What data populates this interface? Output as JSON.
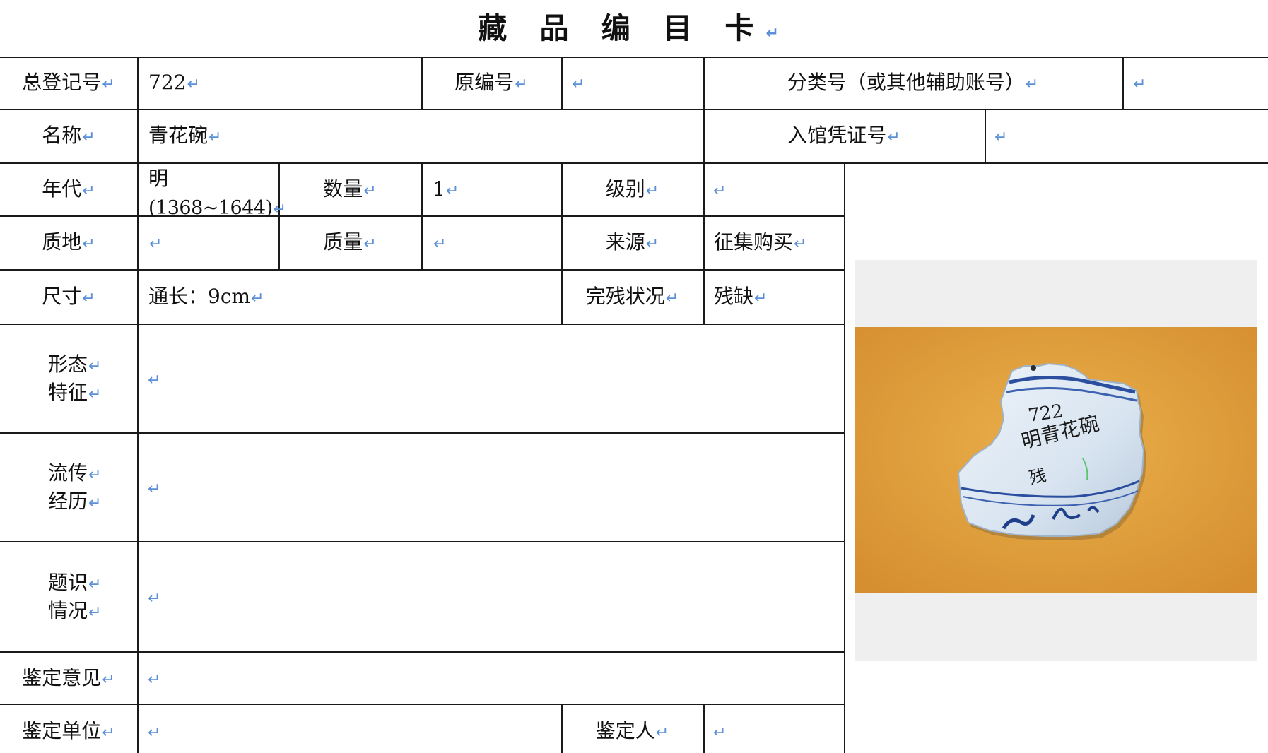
{
  "title": "藏 品 编 目 卡",
  "return_mark": "↵",
  "row1": {
    "total_reg_label": "总登记号",
    "total_reg_value": "722",
    "orig_no_label": "原编号",
    "orig_no_value": "",
    "class_no_label": "分类号（或其他辅助账号）",
    "class_no_value": ""
  },
  "row2": {
    "name_label": "名称",
    "name_value": "青花碗",
    "voucher_label": "入馆凭证号",
    "voucher_value": ""
  },
  "row3": {
    "era_label": "年代",
    "era_value_line1": "明",
    "era_value_line2": "(1368~1644)",
    "qty_label": "数量",
    "qty_value": "1",
    "grade_label": "级别",
    "grade_value": ""
  },
  "row4": {
    "material_label": "质地",
    "material_value": "",
    "weight_label": "质量",
    "weight_value": "",
    "source_label": "来源",
    "source_value": "征集购买"
  },
  "row5": {
    "size_label": "尺寸",
    "size_value": "通长：9cm",
    "condition_label": "完残状况",
    "condition_value": "残缺"
  },
  "form": {
    "label_line1": "形态",
    "label_line2": "特征",
    "value": ""
  },
  "history": {
    "label_line1": "流传",
    "label_line2": "经历",
    "value": ""
  },
  "inscription": {
    "label_line1": "题识",
    "label_line2": "情况",
    "value": ""
  },
  "appraisal": {
    "label": "鉴定意见",
    "value": ""
  },
  "appraisal_unit": {
    "label": "鉴定单位",
    "value": "",
    "person_label": "鉴定人",
    "person_value": ""
  },
  "photo": {
    "handwriting": [
      "722",
      "明青花碗",
      "残"
    ]
  },
  "colors": {
    "border": "#1a1a1a",
    "return_mark": "#5b8fd6",
    "photo_bg": "#e3a23f",
    "porcelain": "#dfe9f3",
    "cobalt": "#2b4f9e"
  }
}
